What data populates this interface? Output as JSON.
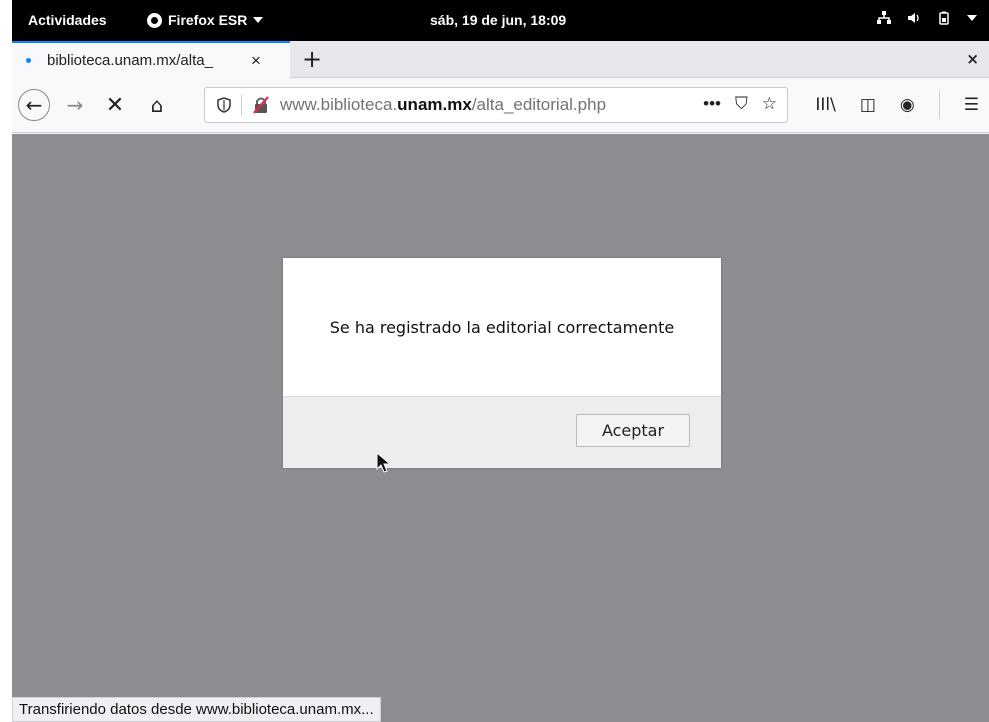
{
  "topbar": {
    "activities": "Actividades",
    "app_name": "Firefox ESR",
    "clock": "sáb, 19 de jun, 18:09",
    "icons": [
      "network-icon",
      "volume-icon",
      "battery-icon",
      "system-menu-caret-icon"
    ]
  },
  "tab": {
    "title": "biblioteca.unam.mx/alta_",
    "close": "×"
  },
  "tabbar": {
    "new_tab": "+",
    "window_close": "×"
  },
  "navbar": {
    "back": "←",
    "forward": "→",
    "stop": "✕",
    "home": "⌂",
    "url_prefix": "www.biblioteca.",
    "url_domain": "unam.mx",
    "url_path": "/alta_editorial.php",
    "page_actions": "•••",
    "pocket": "⛉",
    "bookmark": "☆",
    "library": "IIl\\",
    "sidebar": "◫",
    "account": "◉",
    "menu": "☰"
  },
  "dialog": {
    "message": "Se ha registrado la editorial correctamente",
    "accept_label": "Aceptar"
  },
  "status": {
    "text": "Transfiriendo datos desde www.biblioteca.unam.mx..."
  },
  "colors": {
    "overlay": "#8e8e92",
    "accent": "#0a84ff",
    "topbar": "#000000"
  }
}
